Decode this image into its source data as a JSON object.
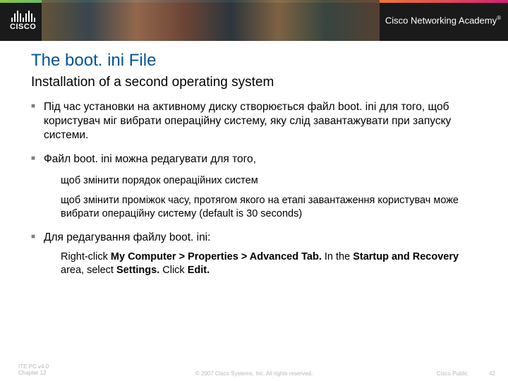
{
  "header": {
    "logo_text": "CISCO",
    "academy": "Cisco Networking Academy"
  },
  "slide": {
    "title": "The boot. ini File",
    "subtitle": "Installation of a second operating system",
    "bullets": {
      "b1": "Під час установки на активному диску створюється файл boot. ini для того, щоб користувач міг вибрати операційну систему, яку слід завантажувати при запуску системи.",
      "b2": "Файл boot. ini можна редагувати для того,",
      "b2_sub1": "щоб змінити порядок операційних систем",
      "b2_sub2": "щоб змінити проміжок часу, протягом якого на етапі завантаження користувач може вибрати операційну систему (default is 30 seconds)",
      "b3": "Для редагування файлу boot. ini:",
      "b3_sub_prefix": "Right-click ",
      "b3_sub_bold1": "My Computer > Properties > Advanced Tab.",
      "b3_sub_mid": " In the ",
      "b3_sub_bold2": "Startup and Recovery",
      "b3_sub_mid2": " area, select ",
      "b3_sub_bold3": "Settings.",
      "b3_sub_mid3": " Click ",
      "b3_sub_bold4": "Edit."
    }
  },
  "footer": {
    "left_line1": "ITE PC v4.0",
    "left_line2": "Chapter 12",
    "center": "© 2007 Cisco Systems, Inc. All rights reserved.",
    "right_label": "Cisco Public",
    "page": "42"
  }
}
